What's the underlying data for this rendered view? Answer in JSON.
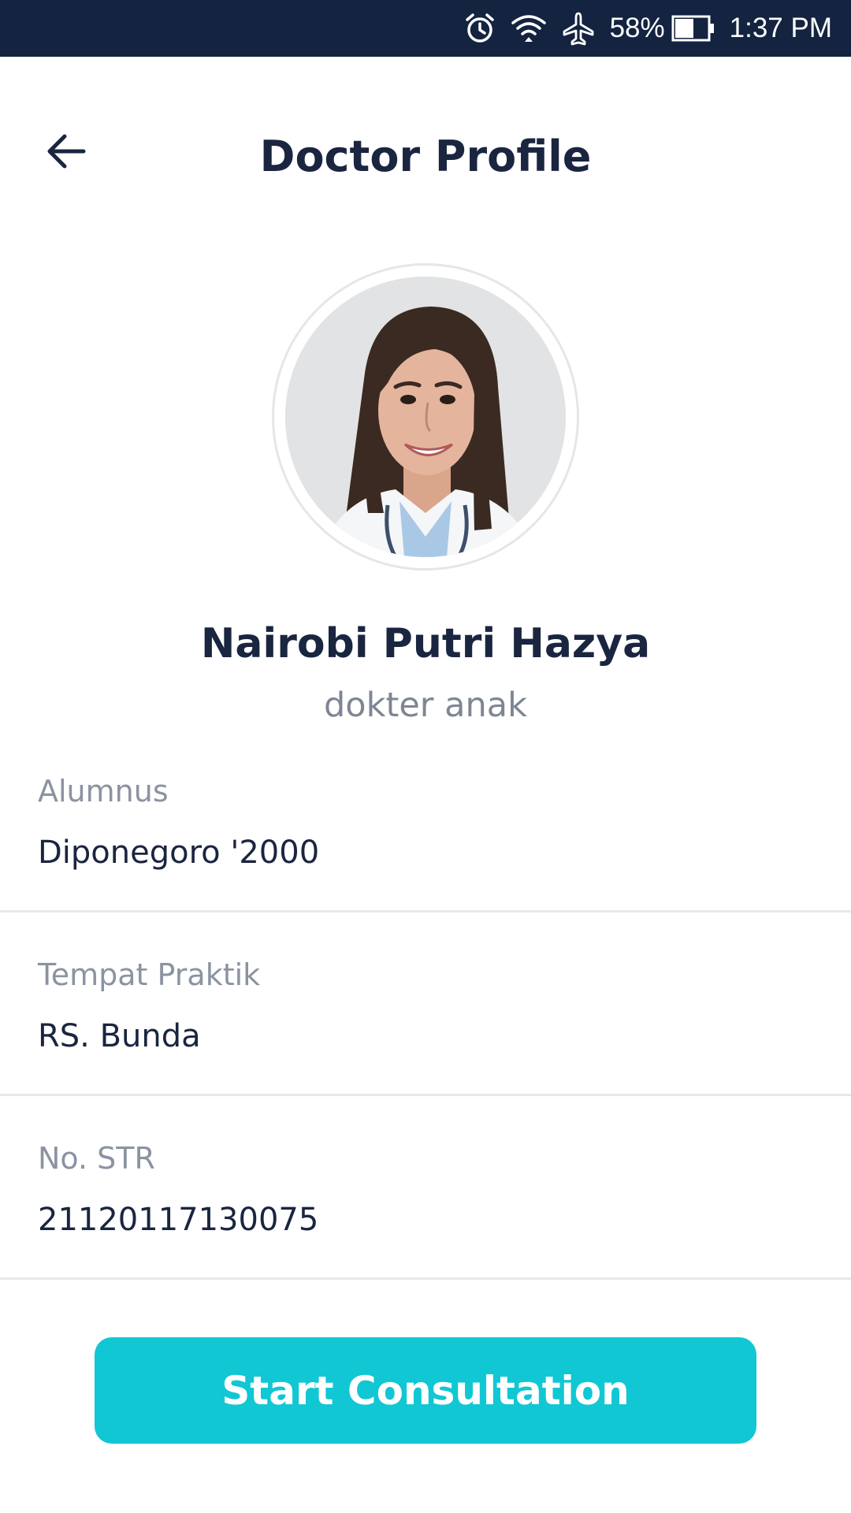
{
  "status_bar": {
    "battery_percent": "58%",
    "time": "1:37 PM",
    "battery_level": 0.58,
    "icons": [
      "alarm-icon",
      "wifi-icon",
      "airplane-icon",
      "battery-icon"
    ]
  },
  "header": {
    "title": "Doctor Profile",
    "back_icon": "arrow-left-icon"
  },
  "doctor": {
    "name": "Nairobi Putri Hazya",
    "specialty": "dokter anak"
  },
  "info": {
    "alumnus_label": "Alumnus",
    "alumnus_value": "Diponegoro '2000",
    "practice_label": "Tempat Praktik",
    "practice_value": "RS. Bunda",
    "str_label": "No. STR",
    "str_value": "21120117130075"
  },
  "actions": {
    "start_label": "Start Consultation"
  },
  "colors": {
    "status_bar": "#132340",
    "title": "#1a2540",
    "muted": "#8b93a1",
    "accent": "#11c7d3",
    "divider": "#e8e8ea"
  }
}
